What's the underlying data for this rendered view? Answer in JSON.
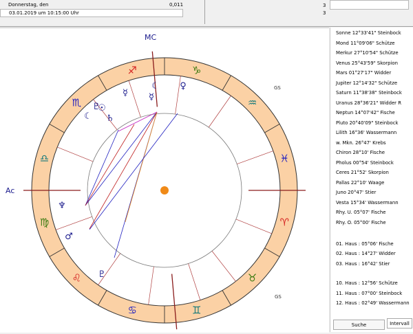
{
  "header": {
    "date_label": "Donnerstag, den",
    "value": "0,011",
    "datetime": "03.01.2019  um  10:15:00 Uhr",
    "count_1": "3",
    "count_2": "3"
  },
  "chart": {
    "mc_label": "MC",
    "asc_label": "Ac",
    "gs_label": "GS",
    "zodiac": [
      {
        "glyph": "♈",
        "name": "aries"
      },
      {
        "glyph": "♉",
        "name": "taurus"
      },
      {
        "glyph": "♊",
        "name": "gemini"
      },
      {
        "glyph": "♋",
        "name": "cancer"
      },
      {
        "glyph": "♌",
        "name": "leo"
      },
      {
        "glyph": "♍",
        "name": "virgo"
      },
      {
        "glyph": "♎",
        "name": "libra"
      },
      {
        "glyph": "♏",
        "name": "scorpio"
      },
      {
        "glyph": "♐",
        "name": "sagittarius"
      },
      {
        "glyph": "♑",
        "name": "capricorn"
      },
      {
        "glyph": "♒",
        "name": "aquarius"
      },
      {
        "glyph": "♓",
        "name": "pisces"
      }
    ],
    "planet_glyphs": {
      "sun": "☉",
      "moon": "☾",
      "mercury": "☿",
      "venus": "♀",
      "mars": "♂",
      "jupiter": "♃",
      "saturn": "♄",
      "uranus": "♅",
      "neptune": "♆",
      "pluto": "♇",
      "node": "☊",
      "lilith": "⚸",
      "chiron": "⚷"
    },
    "colors": {
      "zodiac_band": "#fbd1a5",
      "fire": "#d42020",
      "earth": "#3a7a10",
      "air": "#10787a",
      "water": "#2020c0",
      "planet": "#1a1a8c",
      "center_dot": "#f08a18"
    }
  },
  "positions": [
    "Sonne     12°33'41\" Steinbock",
    "Mond      11°09'06\" Schütze",
    "Merkur    27°10'54\" Schütze",
    "Venus     25°43'59\" Skorpion",
    "Mars      01°27'17\" Widder",
    "Jupiter   12°14'32\" Schütze",
    "Saturn    11°38'38\" Steinbock",
    "Uranus    28°36'21\" Widder R",
    "Neptun   14°07'42\" Fische",
    "Pluto     20°40'09\" Steinbock",
    "Lilith  16°36' Wassermann",
    "w. Mkn.  26°47' Krebs",
    "Chiron   28°10' Fische",
    "Pholus  00°54' Steinbock",
    "Ceres    21°52' Skorpion",
    "Pallas   22°10' Waage",
    "Juno     20°47' Stier",
    "Vesta    15°34' Wassermann",
    "Rhy. U.    05°07' Fische",
    "Rhy. O.    05°00' Fische"
  ],
  "houses": [
    "01. Haus :  05°06' Fische",
    "02. Haus :  14°27' Widder",
    "03. Haus :  16°42' Stier",
    "10. Haus :  12°56' Schütze",
    "11. Haus :  07°00' Steinbock",
    "12. Haus :  02°49' Wassermann"
  ],
  "buttons": {
    "search": "Suche",
    "interval": "Intervall"
  }
}
